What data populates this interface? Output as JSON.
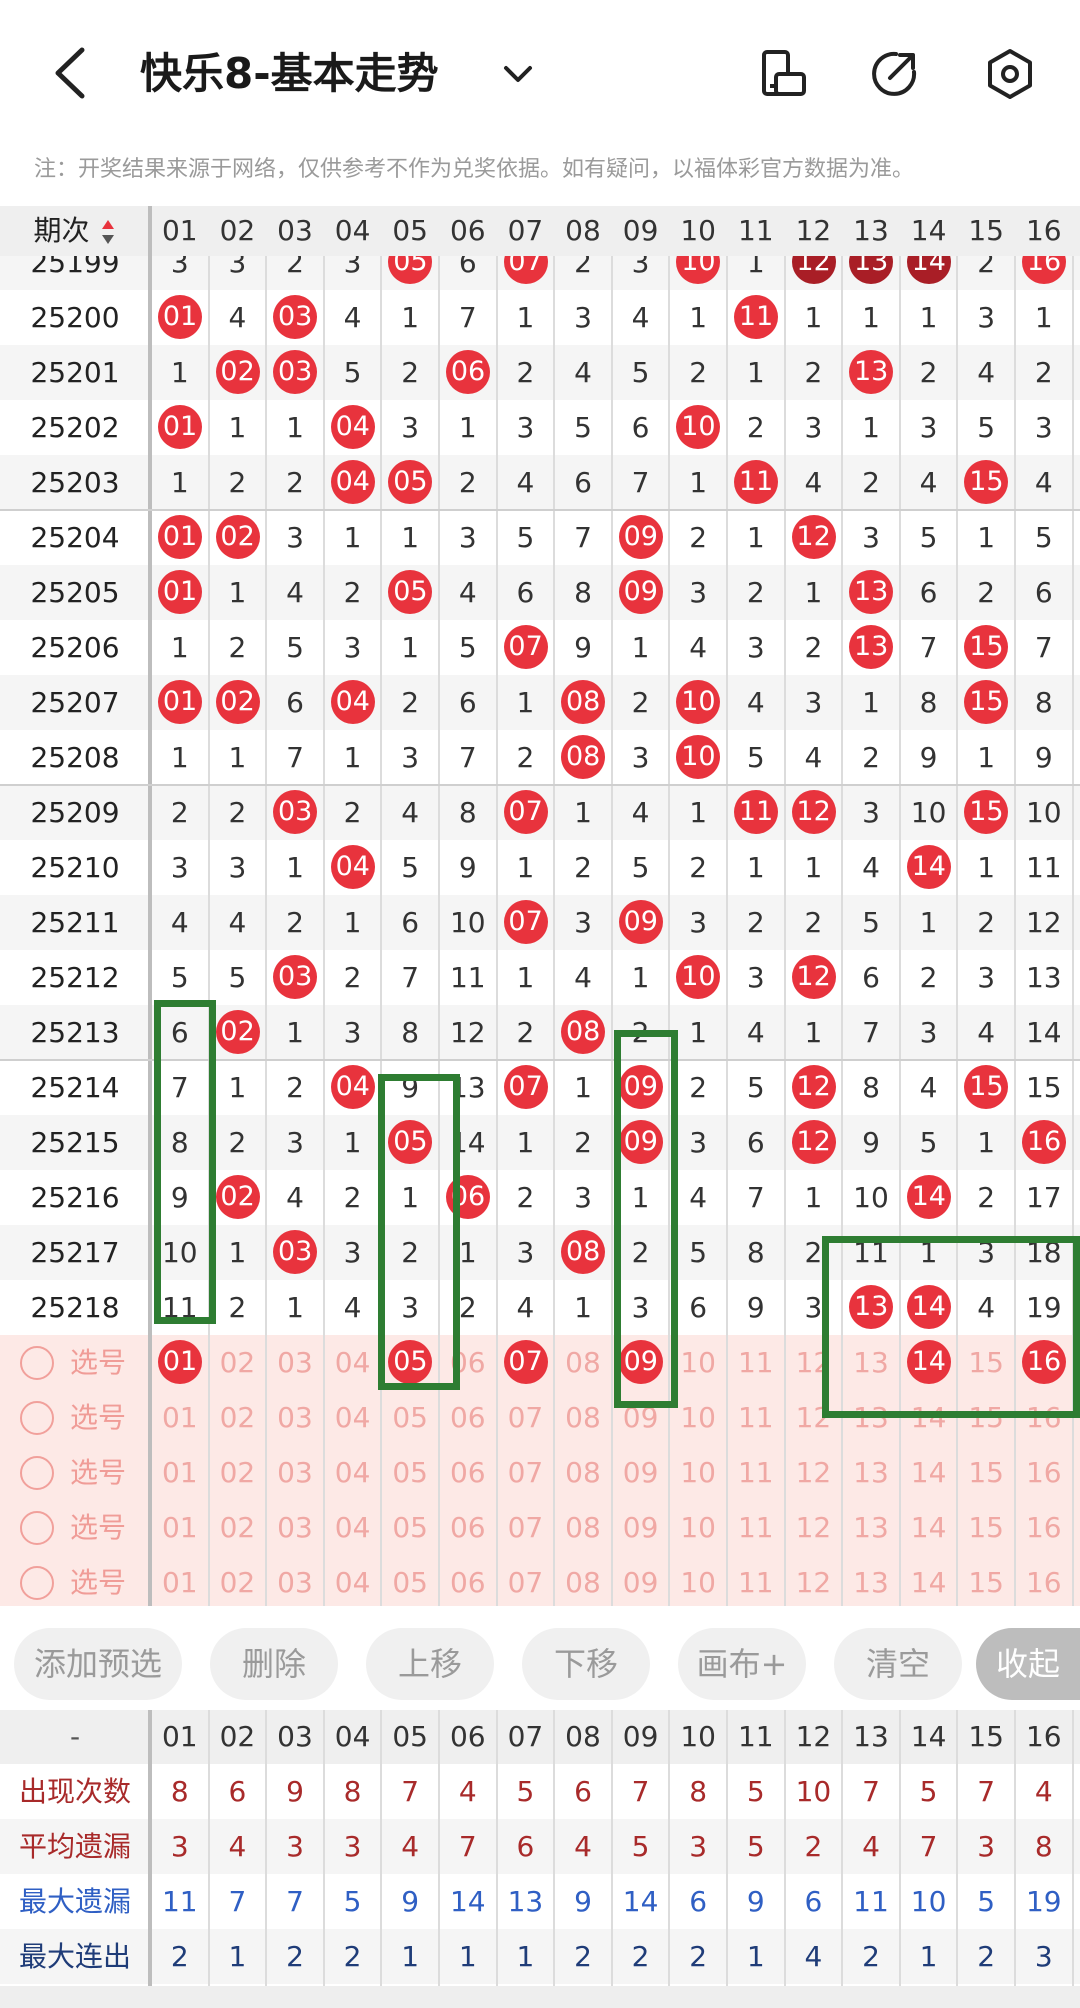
{
  "header": {
    "title": "快乐8-基本走势",
    "icons": [
      "back-icon",
      "chevron-down-icon",
      "phone-rotate-icon",
      "share-icon",
      "settings-icon"
    ]
  },
  "notice": "注：开奖结果来源于网络，仅供参考不作为兑奖依据。如有疑问，以福体彩官方数据为准。",
  "table": {
    "period_header": "期次",
    "columns": [
      "01",
      "02",
      "03",
      "04",
      "05",
      "06",
      "07",
      "08",
      "09",
      "10",
      "11",
      "12",
      "13",
      "14",
      "15",
      "16"
    ],
    "rows": [
      {
        "period": "25199",
        "cells": [
          "3",
          "3",
          "2",
          "3",
          "05",
          "6",
          "07",
          "2",
          "3",
          "10",
          "1",
          "12",
          "13",
          "14",
          "2",
          "16"
        ],
        "dark": [
          11,
          12,
          13
        ]
      },
      {
        "period": "25200",
        "cells": [
          "01",
          "4",
          "03",
          "4",
          "1",
          "7",
          "1",
          "3",
          "4",
          "1",
          "11",
          "1",
          "1",
          "1",
          "3",
          "1"
        ]
      },
      {
        "period": "25201",
        "cells": [
          "1",
          "02",
          "03",
          "5",
          "2",
          "06",
          "2",
          "4",
          "5",
          "2",
          "1",
          "2",
          "13",
          "2",
          "4",
          "2"
        ]
      },
      {
        "period": "25202",
        "cells": [
          "01",
          "1",
          "1",
          "04",
          "3",
          "1",
          "3",
          "5",
          "6",
          "10",
          "2",
          "3",
          "1",
          "3",
          "5",
          "3"
        ]
      },
      {
        "period": "25203",
        "cells": [
          "1",
          "2",
          "2",
          "04",
          "05",
          "2",
          "4",
          "6",
          "7",
          "1",
          "11",
          "4",
          "2",
          "4",
          "15",
          "4"
        ]
      },
      {
        "period": "25204",
        "cells": [
          "01",
          "02",
          "3",
          "1",
          "1",
          "3",
          "5",
          "7",
          "09",
          "2",
          "1",
          "12",
          "3",
          "5",
          "1",
          "5"
        ]
      },
      {
        "period": "25205",
        "cells": [
          "01",
          "1",
          "4",
          "2",
          "05",
          "4",
          "6",
          "8",
          "09",
          "3",
          "2",
          "1",
          "13",
          "6",
          "2",
          "6"
        ]
      },
      {
        "period": "25206",
        "cells": [
          "1",
          "2",
          "5",
          "3",
          "1",
          "5",
          "07",
          "9",
          "1",
          "4",
          "3",
          "2",
          "13",
          "7",
          "15",
          "7"
        ]
      },
      {
        "period": "25207",
        "cells": [
          "01",
          "02",
          "6",
          "04",
          "2",
          "6",
          "1",
          "08",
          "2",
          "10",
          "4",
          "3",
          "1",
          "8",
          "15",
          "8"
        ]
      },
      {
        "period": "25208",
        "cells": [
          "1",
          "1",
          "7",
          "1",
          "3",
          "7",
          "2",
          "08",
          "3",
          "10",
          "5",
          "4",
          "2",
          "9",
          "1",
          "9"
        ]
      },
      {
        "period": "25209",
        "cells": [
          "2",
          "2",
          "03",
          "2",
          "4",
          "8",
          "07",
          "1",
          "4",
          "1",
          "11",
          "12",
          "3",
          "10",
          "15",
          "10"
        ]
      },
      {
        "period": "25210",
        "cells": [
          "3",
          "3",
          "1",
          "04",
          "5",
          "9",
          "1",
          "2",
          "5",
          "2",
          "1",
          "1",
          "4",
          "14",
          "1",
          "11"
        ]
      },
      {
        "period": "25211",
        "cells": [
          "4",
          "4",
          "2",
          "1",
          "6",
          "10",
          "07",
          "3",
          "09",
          "3",
          "2",
          "2",
          "5",
          "1",
          "2",
          "12"
        ]
      },
      {
        "period": "25212",
        "cells": [
          "5",
          "5",
          "03",
          "2",
          "7",
          "11",
          "1",
          "4",
          "1",
          "10",
          "3",
          "12",
          "6",
          "2",
          "3",
          "13"
        ]
      },
      {
        "period": "25213",
        "cells": [
          "6",
          "02",
          "1",
          "3",
          "8",
          "12",
          "2",
          "08",
          "2",
          "1",
          "4",
          "1",
          "7",
          "3",
          "4",
          "14"
        ]
      },
      {
        "period": "25214",
        "cells": [
          "7",
          "1",
          "2",
          "04",
          "9",
          "13",
          "07",
          "1",
          "09",
          "2",
          "5",
          "12",
          "8",
          "4",
          "15",
          "15"
        ]
      },
      {
        "period": "25215",
        "cells": [
          "8",
          "2",
          "3",
          "1",
          "05",
          "14",
          "1",
          "2",
          "09",
          "3",
          "6",
          "12",
          "9",
          "5",
          "1",
          "16"
        ]
      },
      {
        "period": "25216",
        "cells": [
          "9",
          "02",
          "4",
          "2",
          "1",
          "06",
          "2",
          "3",
          "1",
          "4",
          "7",
          "1",
          "10",
          "14",
          "2",
          "17"
        ]
      },
      {
        "period": "25217",
        "cells": [
          "10",
          "1",
          "03",
          "3",
          "2",
          "1",
          "3",
          "08",
          "2",
          "5",
          "8",
          "2",
          "11",
          "1",
          "3",
          "18"
        ]
      },
      {
        "period": "25218",
        "cells": [
          "11",
          "2",
          "1",
          "4",
          "3",
          "2",
          "4",
          "1",
          "3",
          "6",
          "9",
          "3",
          "13",
          "14",
          "4",
          "19"
        ]
      }
    ],
    "selection_label": "选号",
    "selection_rows": [
      {
        "picked": [
          "01",
          "05",
          "07",
          "09",
          "14",
          "16"
        ]
      },
      {
        "picked": []
      },
      {
        "picked": []
      },
      {
        "picked": []
      },
      {
        "picked": []
      }
    ]
  },
  "toolbar": {
    "add": "添加预选",
    "delete": "删除",
    "up": "上移",
    "down": "下移",
    "canvas": "画布+",
    "clear": "清空",
    "collapse": "收起"
  },
  "stats": {
    "header_label": "-",
    "rows": [
      {
        "label": "出现次数",
        "color": "#a82a2a",
        "values": [
          "8",
          "6",
          "9",
          "8",
          "7",
          "4",
          "5",
          "6",
          "7",
          "8",
          "5",
          "10",
          "7",
          "5",
          "7",
          "4"
        ]
      },
      {
        "label": "平均遗漏",
        "color": "#a82a2a",
        "values": [
          "3",
          "4",
          "3",
          "3",
          "4",
          "7",
          "6",
          "4",
          "5",
          "3",
          "5",
          "2",
          "4",
          "7",
          "3",
          "8"
        ]
      },
      {
        "label": "最大遗漏",
        "color": "#2f5fc4",
        "values": [
          "11",
          "7",
          "7",
          "5",
          "9",
          "14",
          "13",
          "9",
          "14",
          "6",
          "9",
          "6",
          "11",
          "10",
          "5",
          "19"
        ]
      },
      {
        "label": "最大连出",
        "color": "#1f3c78",
        "values": [
          "2",
          "1",
          "2",
          "2",
          "1",
          "1",
          "1",
          "2",
          "2",
          "2",
          "1",
          "4",
          "2",
          "1",
          "2",
          "3"
        ]
      }
    ]
  },
  "colors": {
    "ball": "#e8333d",
    "ball_dark": "#a91e26",
    "highlight_box": "#2e7d32",
    "selection_bg": "#fde9e6"
  }
}
